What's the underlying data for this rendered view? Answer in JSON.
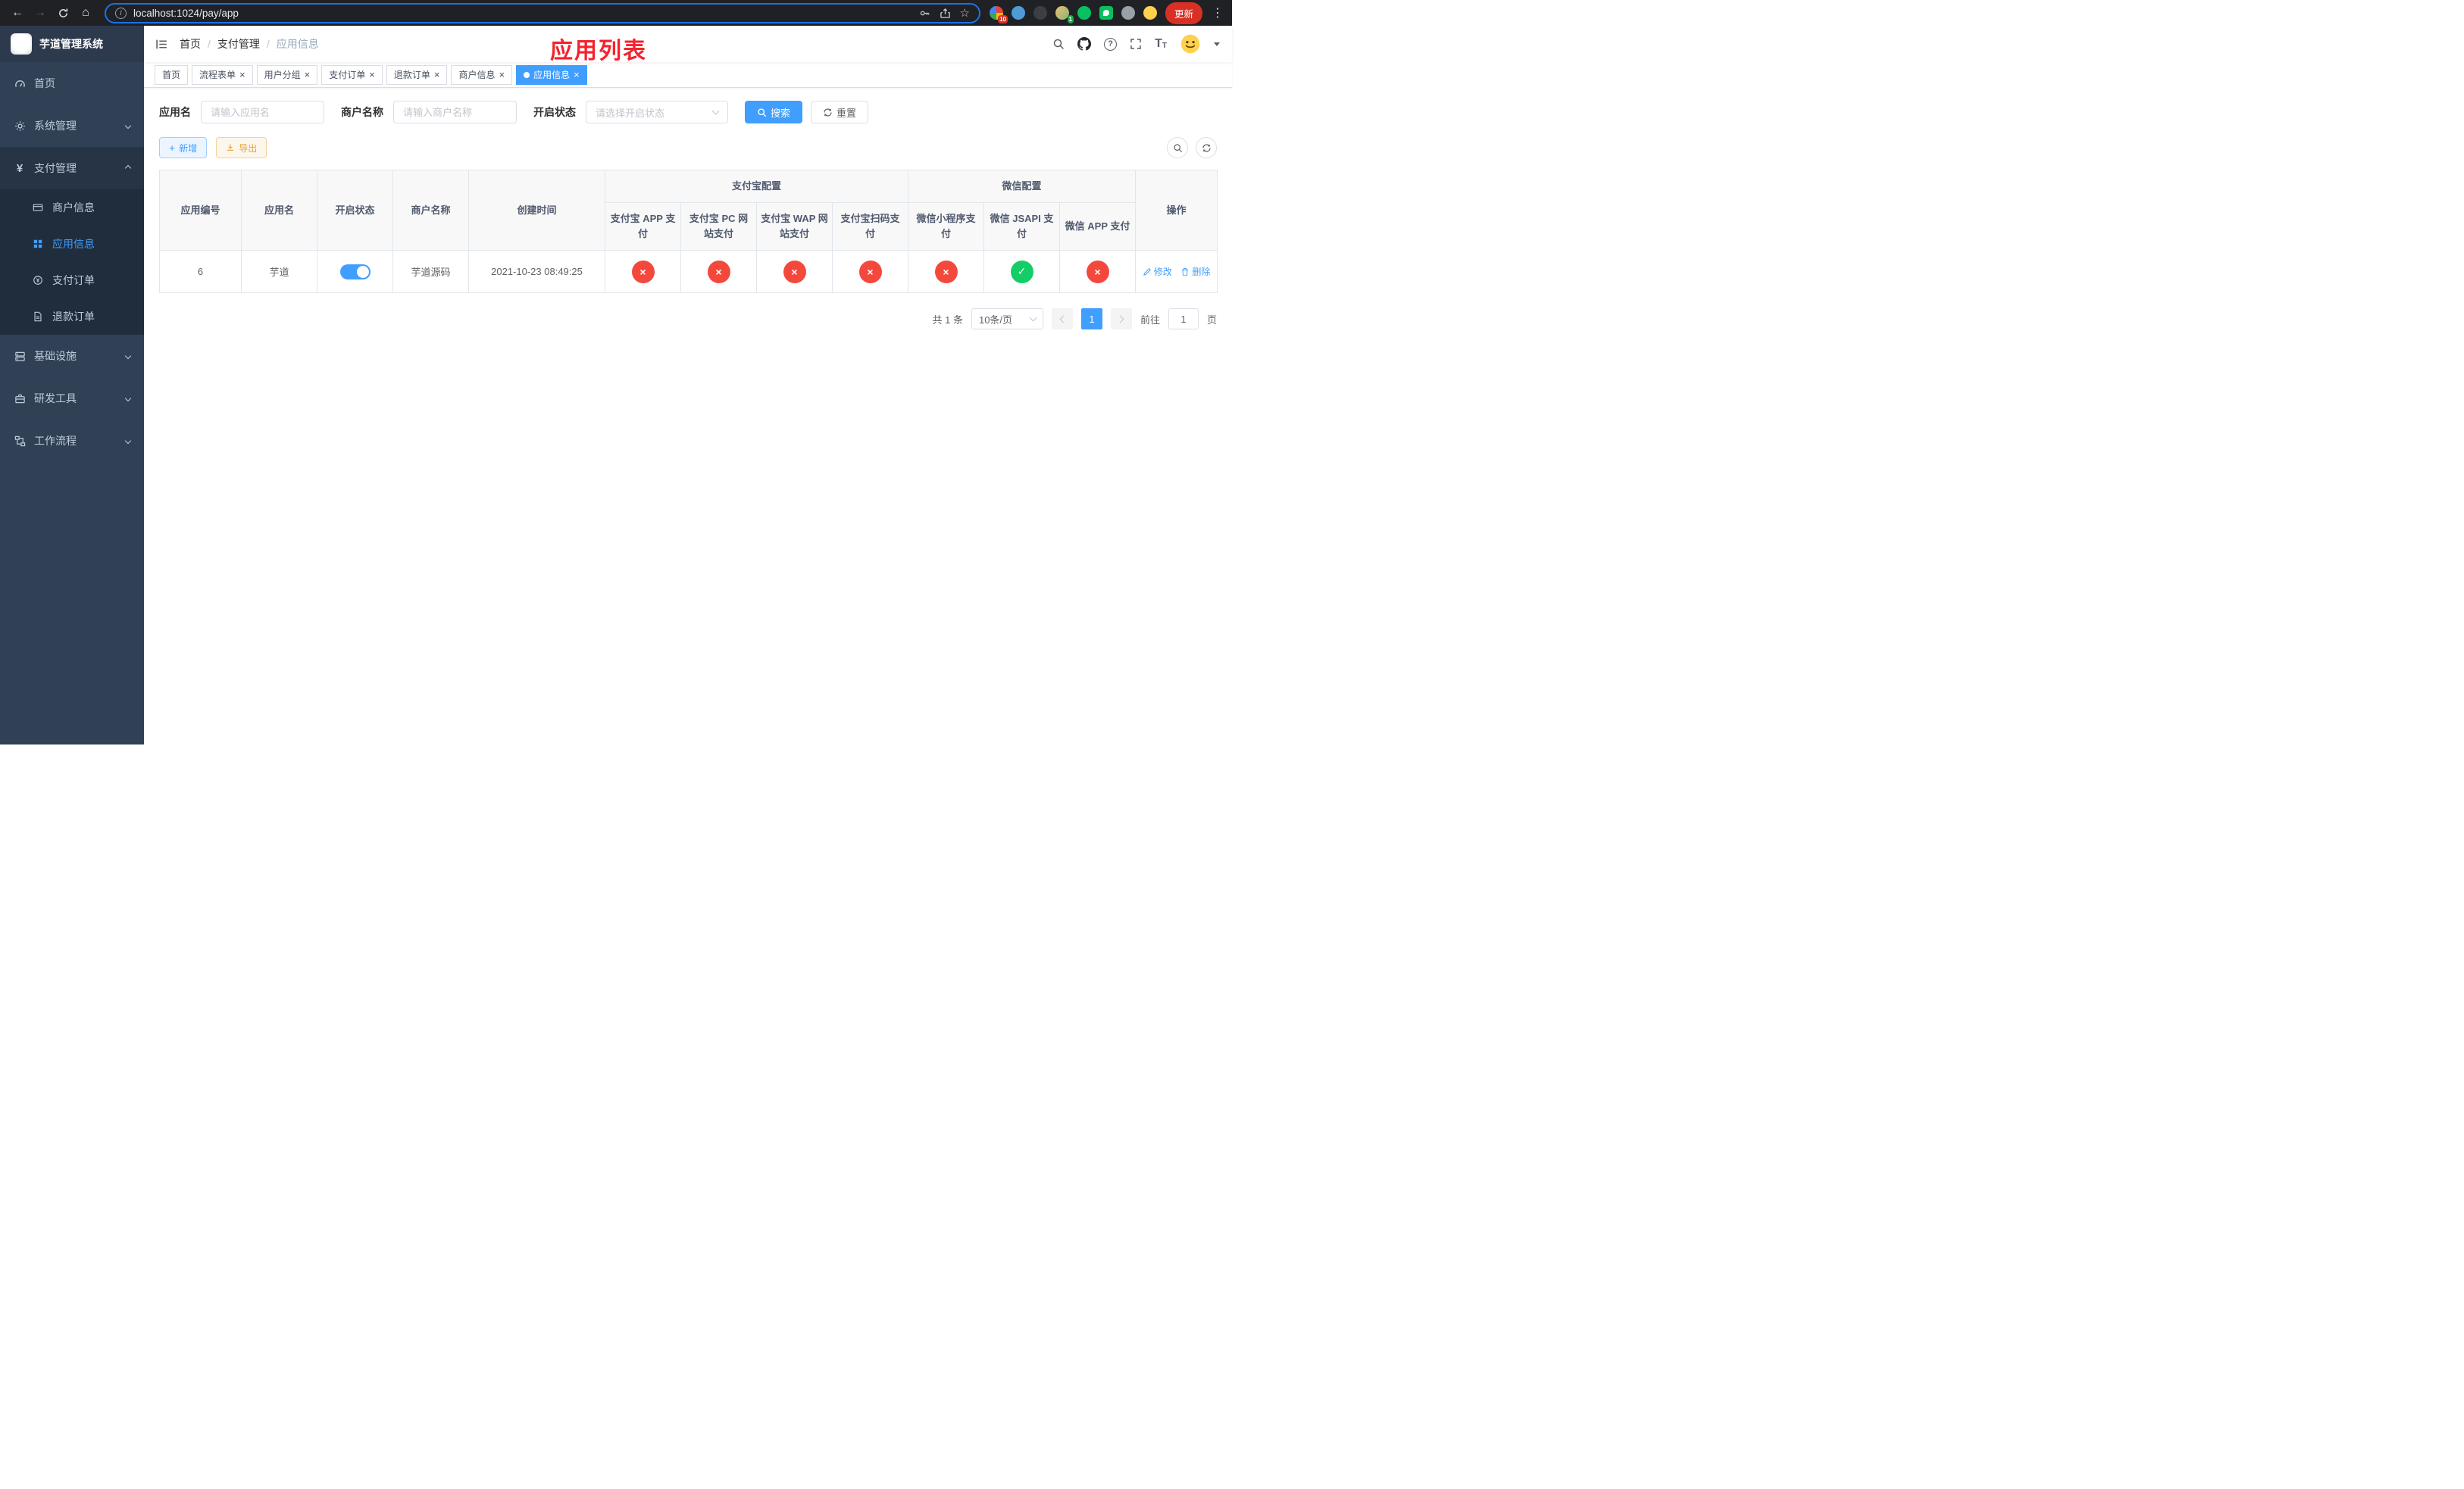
{
  "browser": {
    "url": "localhost:1024/pay/app",
    "update_label": "更新",
    "badges": {
      "extensions": "10",
      "profile": "1"
    }
  },
  "icons": {
    "back": "←",
    "forward": "→",
    "home": "⌂",
    "star": "☆",
    "menu_dots": "⋮",
    "info": "i",
    "question": "?",
    "yen": "¥",
    "plus": "+",
    "close": "×",
    "font_big": "T",
    "font_small": "T"
  },
  "sidebar": {
    "title": "芋道管理系统",
    "menu": [
      {
        "label": "首页"
      },
      {
        "label": "系统管理"
      },
      {
        "label": "支付管理"
      },
      {
        "label": "基础设施"
      },
      {
        "label": "研发工具"
      },
      {
        "label": "工作流程"
      }
    ],
    "payment_children": [
      {
        "label": "商户信息"
      },
      {
        "label": "应用信息"
      },
      {
        "label": "支付订单"
      },
      {
        "label": "退款订单"
      }
    ]
  },
  "header": {
    "breadcrumb": [
      "首页",
      "支付管理",
      "应用信息"
    ],
    "annotation": "应用列表"
  },
  "tabs": [
    {
      "label": "首页"
    },
    {
      "label": "流程表单"
    },
    {
      "label": "用户分组"
    },
    {
      "label": "支付订单"
    },
    {
      "label": "退款订单"
    },
    {
      "label": "商户信息"
    },
    {
      "label": "应用信息"
    }
  ],
  "filters": {
    "app_name_label": "应用名",
    "app_name_placeholder": "请输入应用名",
    "merchant_name_label": "商户名称",
    "merchant_name_placeholder": "请输入商户名称",
    "status_label": "开启状态",
    "status_placeholder": "请选择开启状态",
    "search_label": "搜索",
    "reset_label": "重置"
  },
  "toolbar": {
    "add_label": "新增",
    "export_label": "导出"
  },
  "table": {
    "headers": {
      "app_id": "应用编号",
      "app_name": "应用名",
      "status": "开启状态",
      "merchant": "商户名称",
      "created": "创建时间",
      "alipay_group": "支付宝配置",
      "wechat_group": "微信配置",
      "alipay_app": "支付宝 APP 支付",
      "alipay_pc": "支付宝 PC 网站支付",
      "alipay_wap": "支付宝 WAP 网站支付",
      "alipay_qr": "支付宝扫码支付",
      "wx_lite": "微信小程序支付",
      "wx_jsapi": "微信 JSAPI 支付",
      "wx_app": "微信 APP 支付",
      "actions": "操作"
    },
    "rows": [
      {
        "app_id": "6",
        "app_name": "芋道",
        "enabled": true,
        "merchant": "芋道源码",
        "created": "2021-10-23 08:49:25",
        "alipay_app": false,
        "alipay_pc": false,
        "alipay_wap": false,
        "alipay_qr": false,
        "wx_lite": false,
        "wx_jsapi": true,
        "wx_app": false,
        "edit_label": "修改",
        "delete_label": "删除"
      }
    ]
  },
  "pagination": {
    "total": "共 1 条",
    "page_size": "10条/页",
    "page": "1",
    "goto_prefix": "前往",
    "goto_value": "1",
    "goto_suffix": "页"
  }
}
